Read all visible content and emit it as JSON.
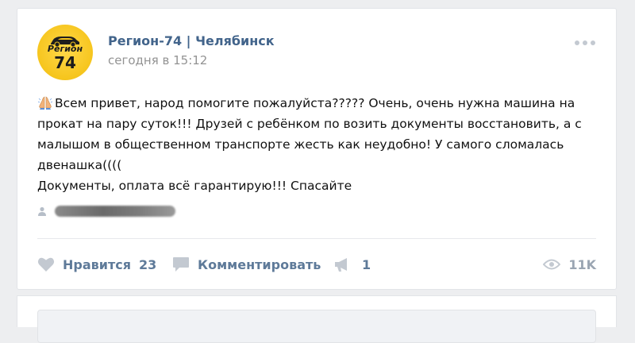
{
  "post": {
    "group_name": "Регион-74 | Челябинск",
    "time": "сегодня в 15:12",
    "avatar": {
      "line1": "Регион",
      "line2": "74",
      "bg_color": "#f6c51d"
    },
    "text_lines": [
      "Всем привет, народ помогите пожалуйста????? Очень, очень нужна машина на",
      "прокат на пару суток!!! Друзей с ребёнком по возить документы восстановить, а с",
      "малышом в общественном транспорте жесть как неудобно! У самого сломалась",
      "двенашка((((",
      "Документы, оплата всё гарантирую!!! Спасайте"
    ],
    "emoji": "praying-hands-emoji",
    "signer_icon": "person-icon"
  },
  "actions": {
    "like_label": "Нравится",
    "like_count": "23",
    "comment_label": "Комментировать",
    "share_count": "1",
    "views_count": "11K"
  },
  "colors": {
    "link": "#42648b",
    "action": "#5e7a99",
    "muted": "#939393",
    "icon": "#c3c9d1",
    "page_bg": "#edeef0"
  }
}
